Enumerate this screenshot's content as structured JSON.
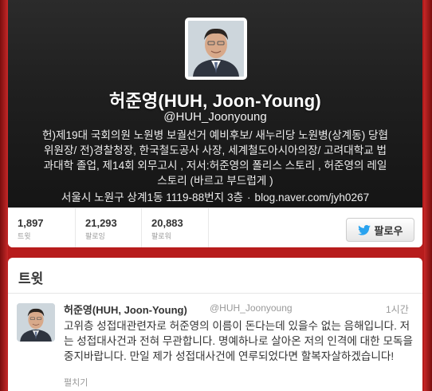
{
  "profile": {
    "name": "허준영(HUH, Joon-Young)",
    "handle": "@HUH_Joonyoung",
    "bio": "헌)제19대 국회의원 노원병 보궐선거 예비후보/ 새누리당 노원병(상계동) 당협위원장/ 전)경찰청장, 한국철도공사 사장, 세계철도아시아의장/ 고려대학교 법과대학 졸업, 제14회 외무고시 , 저서:허준영의 폴리스 스토리 , 허준영의 레일스토리 (바르고 부드럽게 )",
    "location": "서울시 노원구 상계1동 1119-88번지 3층",
    "separator": "·",
    "url": "blog.naver.com/jyh0267"
  },
  "stats": {
    "tweets": {
      "value": "1,897",
      "label": "트윗"
    },
    "following": {
      "value": "21,293",
      "label": "팔로잉"
    },
    "followers": {
      "value": "20,883",
      "label": "팔로워"
    }
  },
  "follow_button": {
    "label": "팔로우",
    "icon": "twitter-bird-icon"
  },
  "timeline": {
    "title": "트윗",
    "tweet": {
      "author": "허준영(HUH, Joon-Young)",
      "handle": "@HUH_Joonyoung",
      "time": "1시간",
      "text": "고위층 성접대관련자로 허준영의 이름이 돈다는데 있을수 없는 음해입니다. 저는 성접대사건과 전혀 무관합니다. 명예하나로 살아온 저의 인격에 대한 모독을 중지바랍니다. 만일 제가 성접대사건에 연루되었다면 할복자살하겠습니다!",
      "expand": "펼치기"
    }
  },
  "colors": {
    "background": "#b71c1c",
    "header_dark": "#1f1f1f",
    "twitter_blue": "#2aa3ef"
  }
}
